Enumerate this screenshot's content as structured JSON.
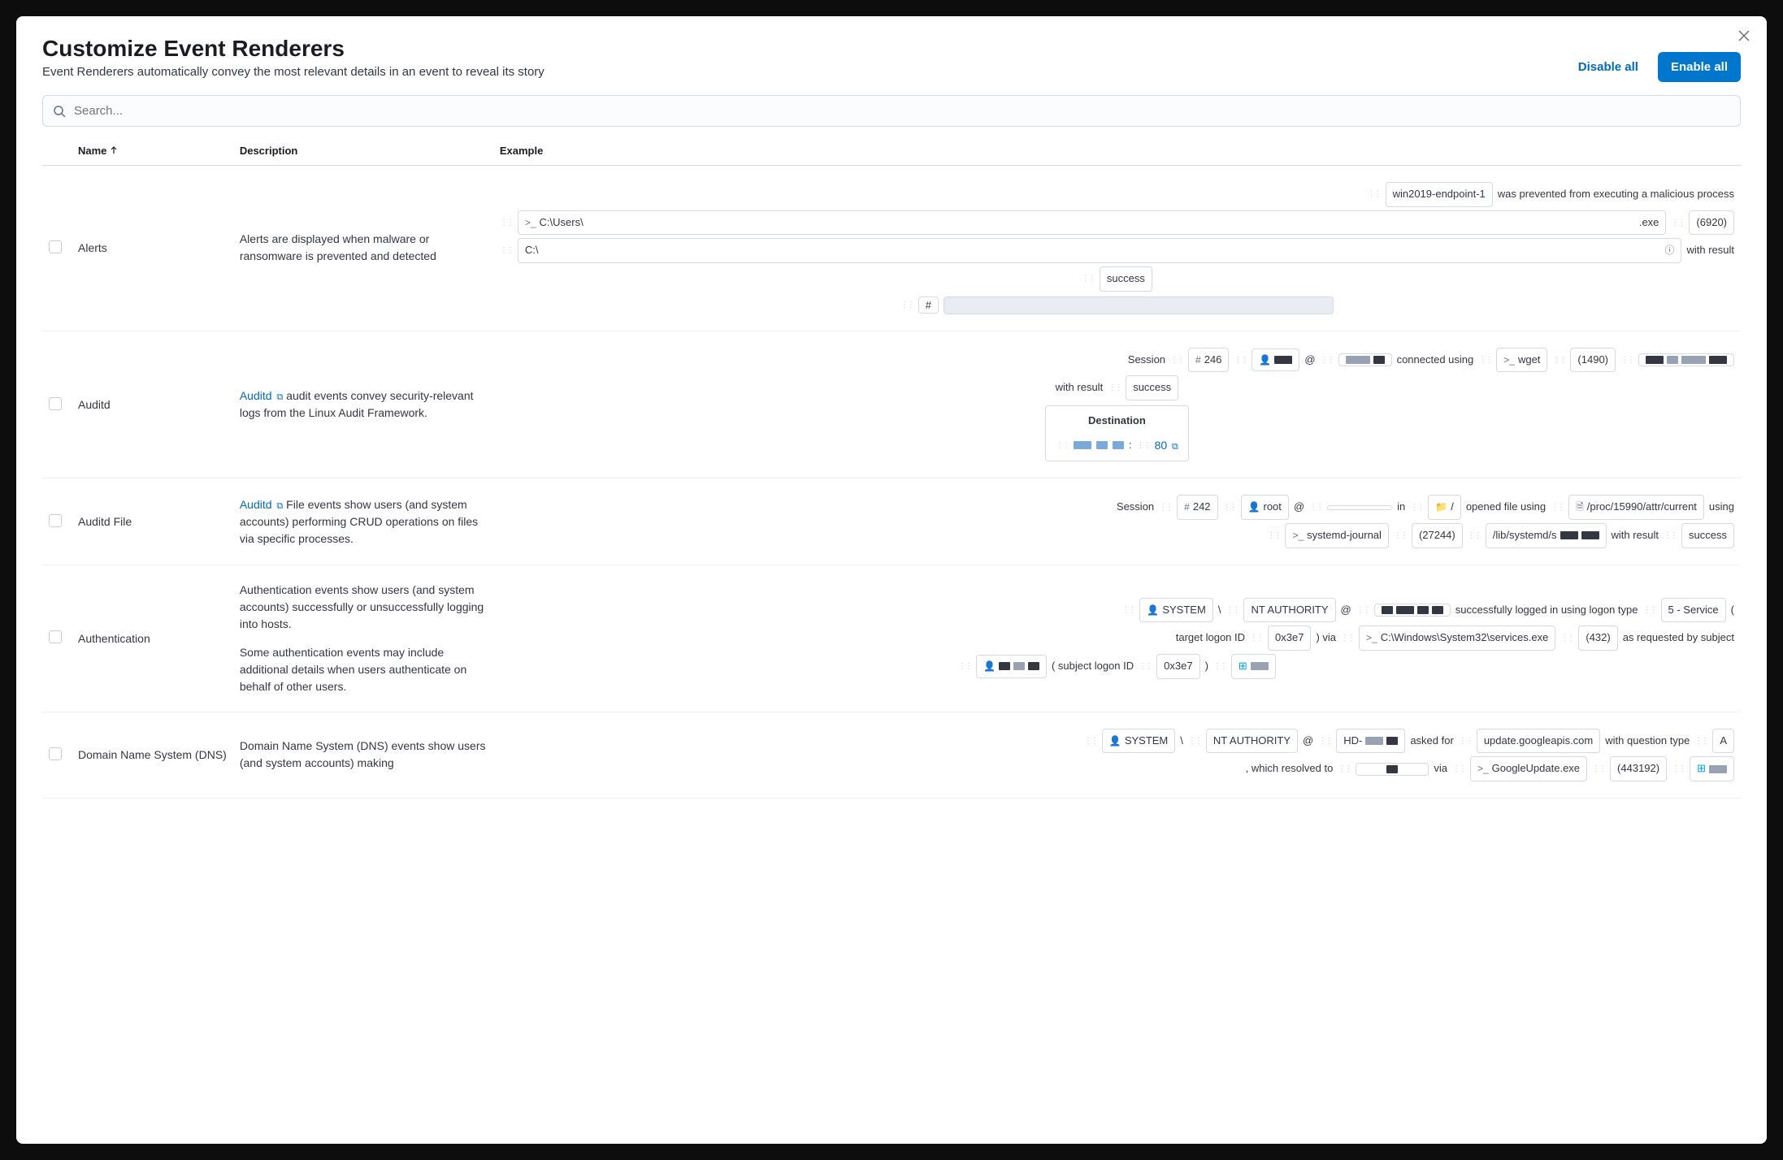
{
  "modal": {
    "title": "Customize Event Renderers",
    "subtitle": "Event Renderers automatically convey the most relevant details in an event to reveal its story",
    "disable_all": "Disable all",
    "enable_all": "Enable all"
  },
  "search": {
    "placeholder": "Search..."
  },
  "columns": {
    "name": "Name",
    "description": "Description",
    "example": "Example"
  },
  "rows": [
    {
      "name": "Alerts",
      "description": "Alerts are displayed when malware or ransomware is prevented and detected",
      "ex": {
        "host": "win2019-endpoint-1",
        "t1": "was prevented from executing a malicious process",
        "path1_prefix": "C:\\Users\\",
        "path1_suffix": ".exe",
        "pid": "(6920)",
        "path2_prefix": "C:\\",
        "t2": "with result",
        "result": "success",
        "hash": "#"
      }
    },
    {
      "name": "Auditd",
      "link_text": "Auditd",
      "description": " audit events convey security-relevant logs from the Linux Audit Framework.",
      "ex": {
        "session_lbl": "Session",
        "session": "246",
        "at": "@",
        "t1": "connected using",
        "proc": "wget",
        "pid": "(1490)",
        "t2": "with result",
        "result": "success",
        "dest_lbl": "Destination",
        "port": "80"
      }
    },
    {
      "name": "Auditd File",
      "link_text": "Auditd",
      "description": " File events show users (and system accounts) performing CRUD operations on files via specific processes.",
      "ex": {
        "session_lbl": "Session",
        "session": "242",
        "user": "root",
        "at": "@",
        "in": "in",
        "folder": "/",
        "t1": "opened file using",
        "file": "/proc/15990/attr/current",
        "t2": "using",
        "proc": "systemd-journal",
        "pid": "(27244)",
        "lib": "/lib/systemd/s",
        "t3": "with result",
        "result": "success"
      }
    },
    {
      "name": "Authentication",
      "description_p1": "Authentication events show users (and system accounts) successfully or unsuccessfully logging into hosts.",
      "description_p2": "Some authentication events may include additional details when users authenticate on behalf of other users.",
      "ex": {
        "user": "SYSTEM",
        "sep": "\\",
        "auth": "NT AUTHORITY",
        "at": "@",
        "t1": "successfully logged in using logon type",
        "logon": "5 - Service",
        "paren_o": "(",
        "t2": "target logon ID",
        "tlid": "0x3e7",
        "paren_c_via": ") via",
        "exe": "C:\\Windows\\System32\\services.exe",
        "pid": "(432)",
        "t3": "as requested by subject",
        "paren_o2": "( subject logon ID",
        "slid": "0x3e7",
        "paren_c": ")"
      }
    },
    {
      "name": "Domain Name System (DNS)",
      "description": "Domain Name System (DNS) events show users (and system accounts) making",
      "ex": {
        "user": "SYSTEM",
        "sep": "\\",
        "auth": "NT AUTHORITY",
        "at": "@",
        "host_prefix": "HD-",
        "t1": "asked for",
        "domain": "update.googleapis.com",
        "t2": "with question type",
        "qtype": "A",
        "t3": ", which resolved to",
        "t4": "via",
        "proc": "GoogleUpdate.exe",
        "pid": "(443192)"
      }
    }
  ]
}
